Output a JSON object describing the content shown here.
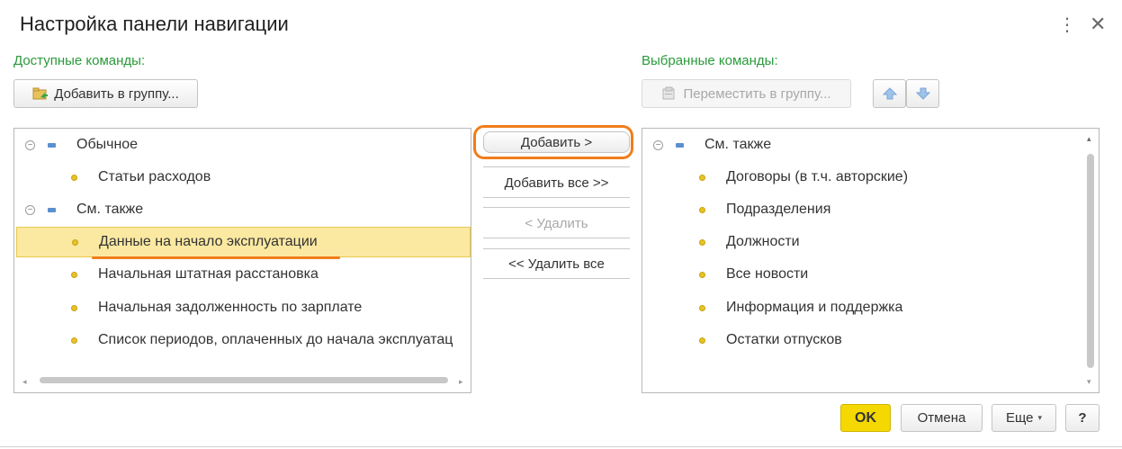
{
  "window": {
    "title": "Настройка панели навигации",
    "menu_icon": "more-vertical-icon",
    "close_icon": "close-icon"
  },
  "available": {
    "label": "Доступные команды:",
    "add_to_group_label": "Добавить в группу...",
    "groups": [
      {
        "label": "Обычное",
        "items": [
          "Статьи расходов"
        ]
      },
      {
        "label": "См. также",
        "items": [
          "Данные на начало эксплуатации",
          "Начальная штатная расстановка",
          "Начальная задолженность по зарплате",
          "Список периодов, оплаченных до начала эксплуатац"
        ]
      }
    ],
    "selected_item": "Данные на начало эксплуатации"
  },
  "actions": {
    "add": "Добавить >",
    "add_all": "Добавить все >>",
    "remove": "< Удалить",
    "remove_all": "<< Удалить все"
  },
  "selected": {
    "label": "Выбранные команды:",
    "move_to_group_label": "Переместить в группу...",
    "groups": [
      {
        "label": "См. также",
        "items": [
          "Договоры (в т.ч. авторские)",
          "Подразделения",
          "Должности",
          "Все новости",
          "Информация и поддержка",
          "Остатки отпусков"
        ]
      }
    ]
  },
  "footer": {
    "ok": "OK",
    "cancel": "Отмена",
    "more": "Еще",
    "help": "?"
  },
  "colors": {
    "accent_green": "#2a9a3a",
    "selection": "#fbe9a2",
    "highlight_orange": "#f07d1a",
    "ok_yellow": "#f5d800"
  }
}
